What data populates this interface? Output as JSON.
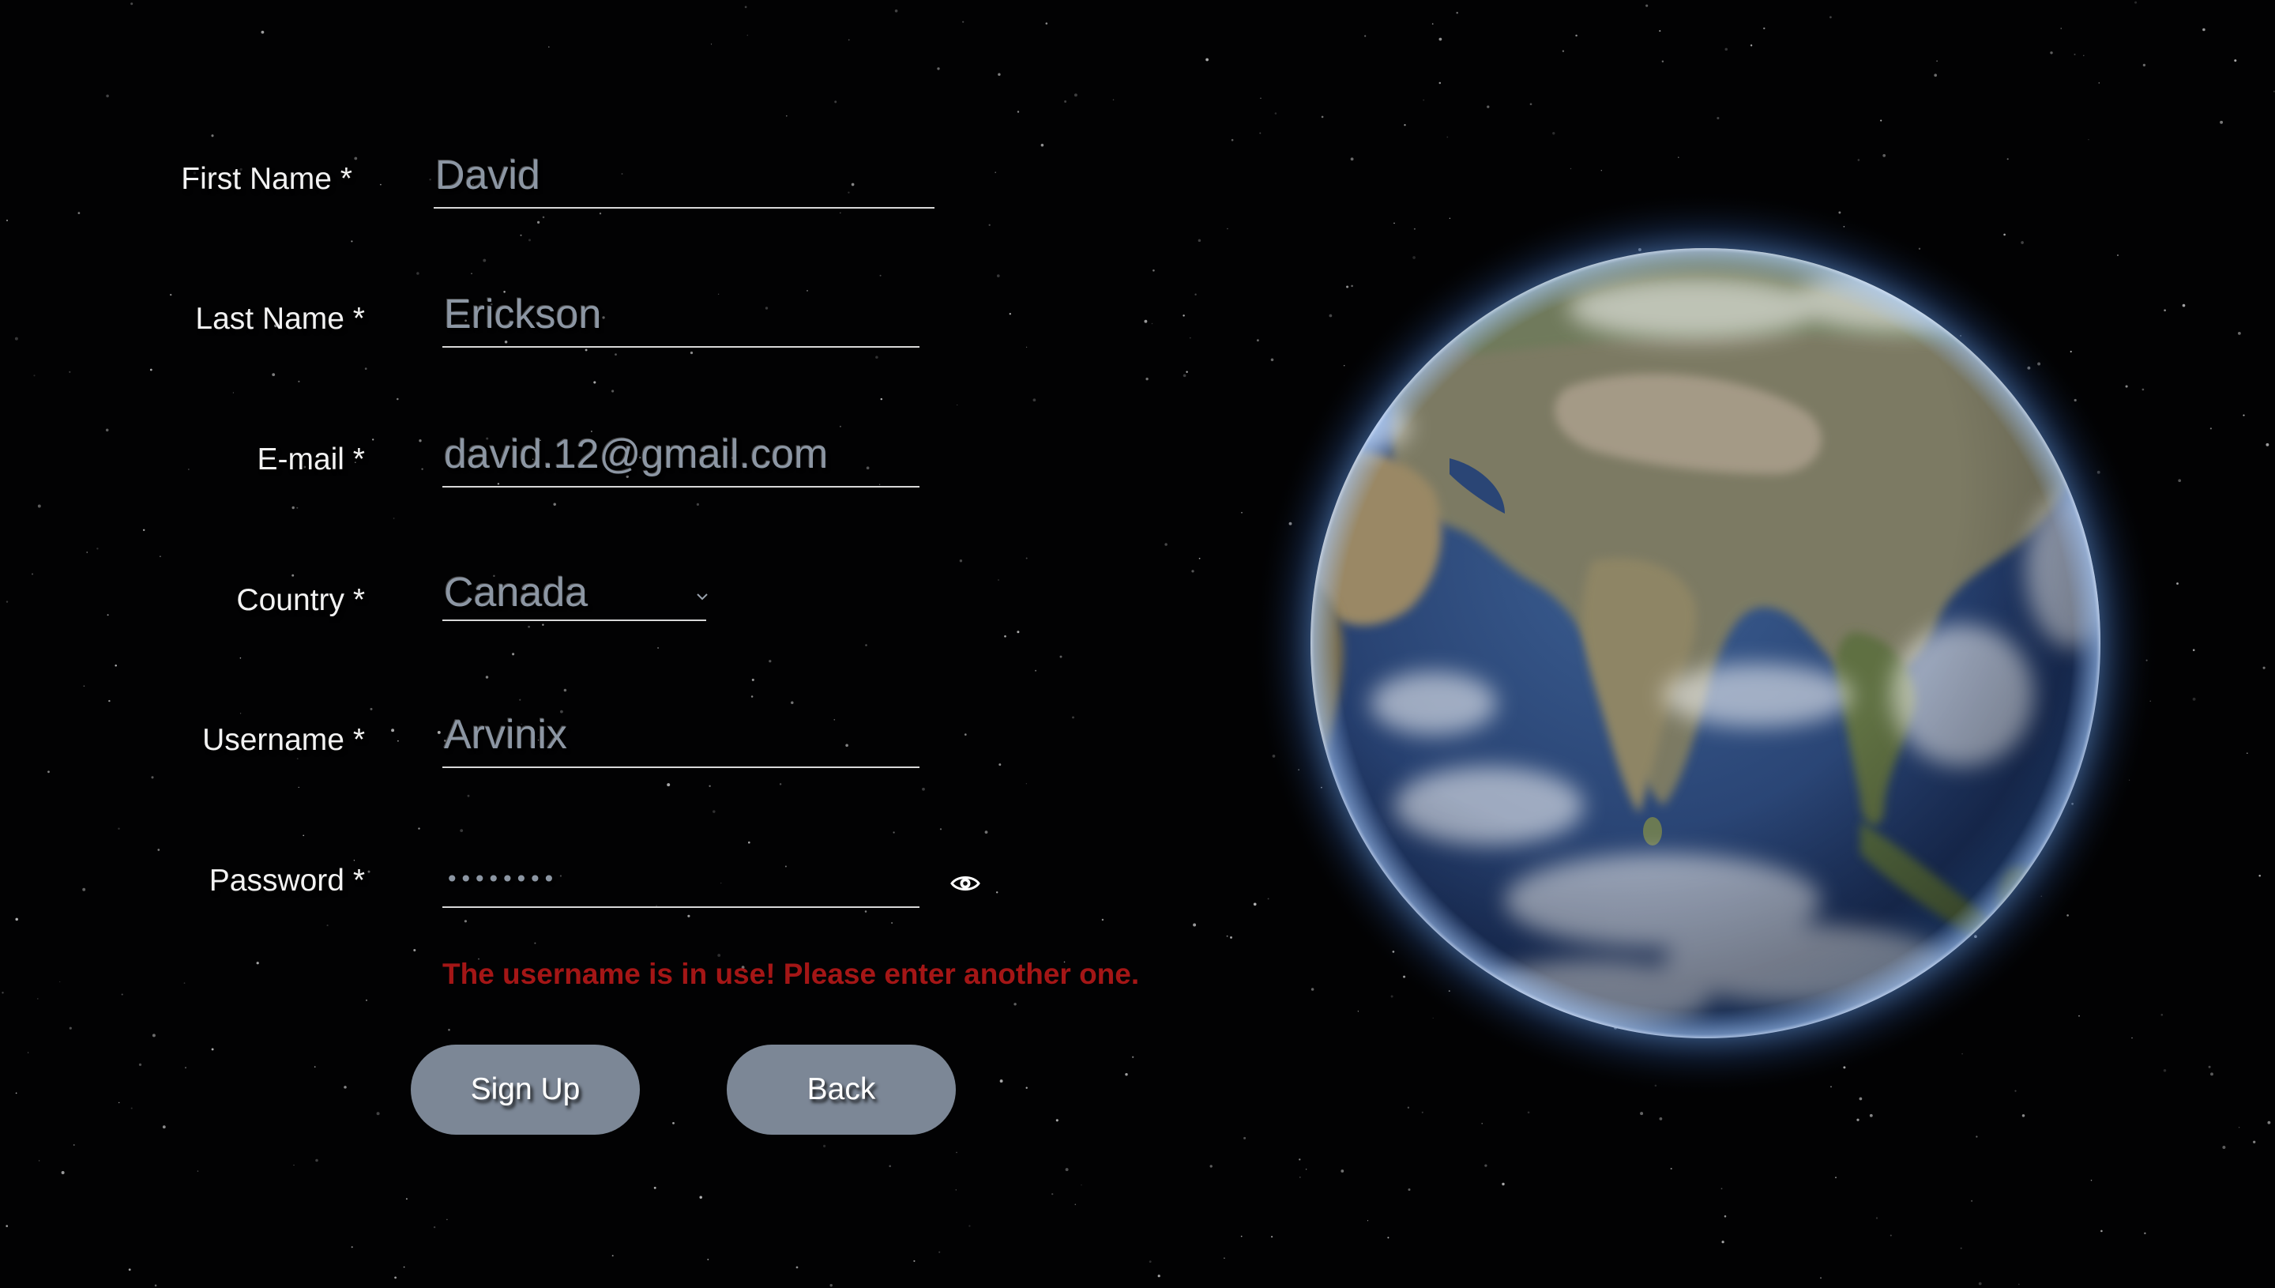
{
  "form": {
    "first_name": {
      "label": "First Name *",
      "value": "David"
    },
    "last_name": {
      "label": "Last Name *",
      "value": "Erickson"
    },
    "email": {
      "label": "E-mail *",
      "value": "david.12@gmail.com"
    },
    "country": {
      "label": "Country *",
      "value": "Canada"
    },
    "username": {
      "label": "Username *",
      "value": "Arvinix"
    },
    "password": {
      "label": "Password *",
      "masked_value": "••••••••"
    },
    "error_message": "The username is in use! Please enter another one.",
    "signup_label": "Sign Up",
    "back_label": "Back"
  },
  "icons": {
    "dropdown": "chevron-down-icon",
    "toggle_password": "eye-icon",
    "decoration": "earth-globe"
  },
  "colors": {
    "background": "#020203",
    "label_text": "#f2f2f2",
    "input_text": "#8c96a3",
    "underline": "#d8d8d8",
    "error_text": "#a41616",
    "button_bg": "#7c8796",
    "button_text": "#ffffff"
  }
}
